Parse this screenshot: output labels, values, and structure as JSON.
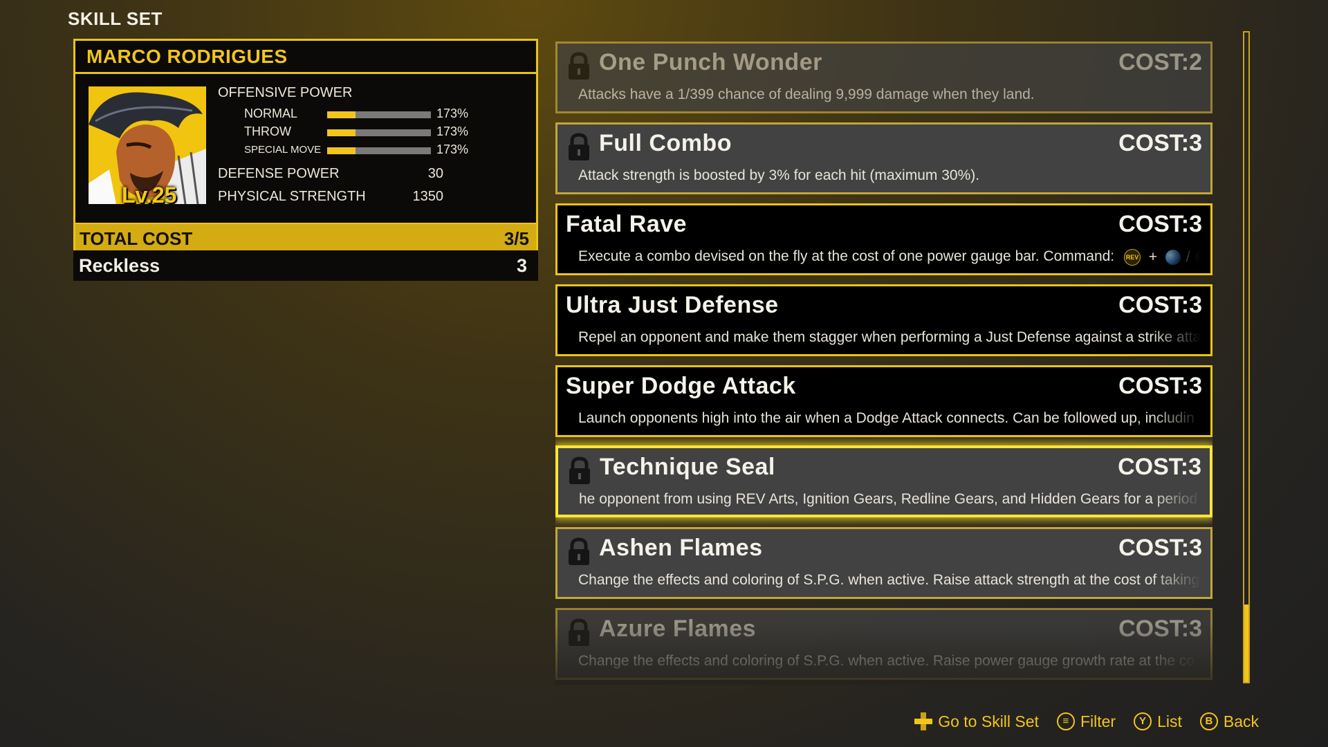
{
  "screen": {
    "title": "SKILL SET"
  },
  "character": {
    "name": "MARCO RODRIGUES",
    "level": "Lv.25",
    "offensive_power_label": "OFFENSIVE POWER",
    "stats": [
      {
        "label": "NORMAL",
        "value": "173%",
        "bar_fraction": 0.27
      },
      {
        "label": "THROW",
        "value": "173%",
        "bar_fraction": 0.27
      },
      {
        "label": "SPECIAL MOVE",
        "value": "173%",
        "bar_fraction": 0.27
      }
    ],
    "defense_power": {
      "label": "DEFENSE POWER",
      "value": "30"
    },
    "physical_strength": {
      "label": "PHYSICAL STRENGTH",
      "value": "1350"
    }
  },
  "total_cost": {
    "label": "TOTAL COST",
    "value": "3/5"
  },
  "equipped": {
    "name": "Reckless",
    "cost": "3"
  },
  "skills": [
    {
      "name": "One Punch Wonder",
      "cost": "COST:2",
      "desc": "Attacks have a 1/399 chance of dealing 9,999 damage when they land.",
      "state": "locked"
    },
    {
      "name": "Full Combo",
      "cost": "COST:3",
      "desc": "Attack strength is boosted by 3% for each hit (maximum 30%).",
      "state": "locked"
    },
    {
      "name": "Fatal Rave",
      "cost": "COST:3",
      "desc": "Execute a combo devised on the fly at the cost of one power gauge bar. Command:",
      "cmd_plus": "+",
      "cmd_slash": "/",
      "cmd_rev": "REV",
      "state": "unlocked"
    },
    {
      "name": "Ultra Just Defense",
      "cost": "COST:3",
      "desc": "Repel an opponent and make them stagger when performing a Just Defense against a strike atta",
      "state": "unlocked"
    },
    {
      "name": "Super Dodge Attack",
      "cost": "COST:3",
      "desc": "Launch opponents high into the air when a Dodge Attack connects. Can be followed up, includin",
      "state": "unlocked"
    },
    {
      "name": "Technique Seal",
      "cost": "COST:3",
      "desc": "he opponent from using REV Arts, Ignition Gears, Redline Gears, and Hidden Gears for a period o",
      "state": "locked-selected"
    },
    {
      "name": "Ashen Flames",
      "cost": "COST:3",
      "desc": "Change the effects and coloring of S.P.G. when active. Raise attack strength at the cost of taking",
      "state": "locked"
    },
    {
      "name": "Azure Flames",
      "cost": "COST:3",
      "desc": "Change the effects and coloring of S.P.G. when active. Raise power gauge growth rate at the co",
      "state": "locked"
    }
  ],
  "footer": {
    "go_to": "Go to Skill Set",
    "filter": "Filter",
    "list": "List",
    "back": "Back",
    "btn_y": "Y",
    "btn_b": "B",
    "btn_menu": "≡"
  },
  "colors": {
    "accent": "#f2c51b",
    "panel": "#0b0a08",
    "locked_card": "#424242"
  },
  "scroll_position_fraction": 0.88
}
